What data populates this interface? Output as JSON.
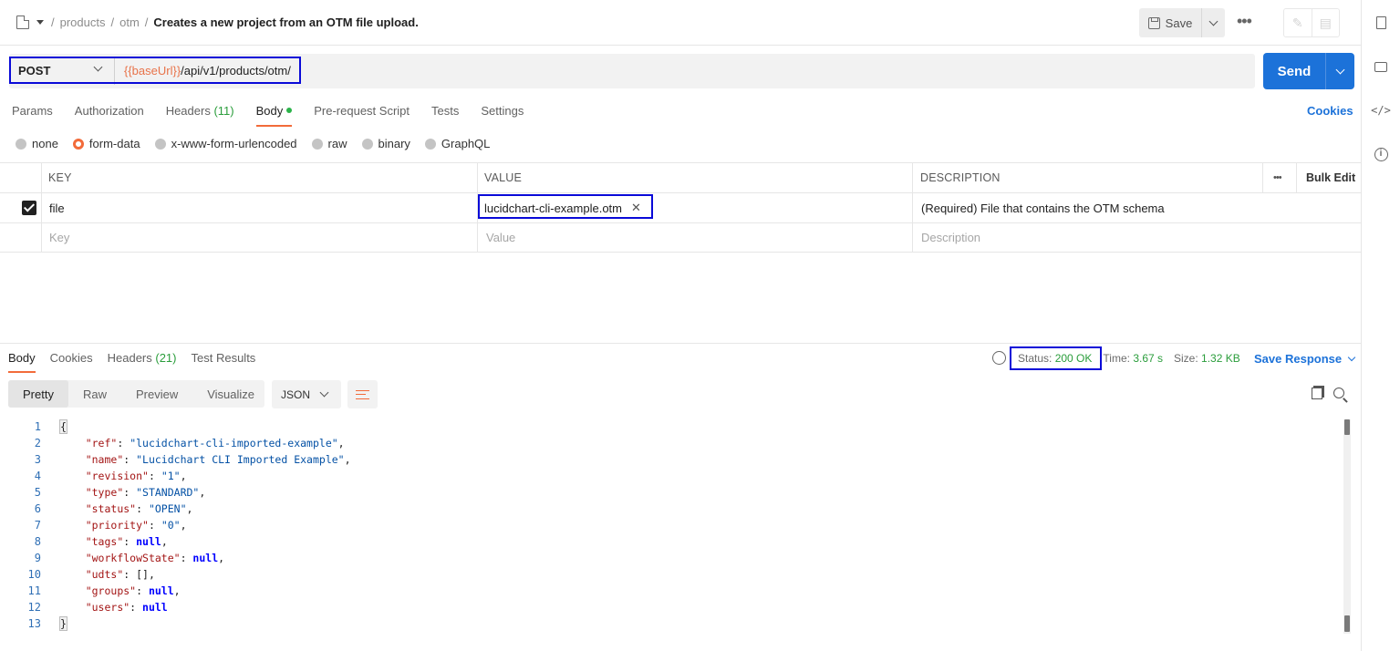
{
  "breadcrumb": {
    "segments": [
      "products",
      "otm"
    ],
    "separator": "/",
    "current": "Creates a new project from an OTM file upload."
  },
  "toolbar": {
    "save_label": "Save",
    "more_label": "•••"
  },
  "request": {
    "method": "POST",
    "url_variable": "{{baseUrl}}",
    "url_path": "/api/v1/products/otm/",
    "send_label": "Send"
  },
  "request_tabs": [
    {
      "label": "Params"
    },
    {
      "label": "Authorization"
    },
    {
      "label": "Headers",
      "count": "(11)"
    },
    {
      "label": "Body",
      "active": true
    },
    {
      "label": "Pre-request Script"
    },
    {
      "label": "Tests"
    },
    {
      "label": "Settings"
    }
  ],
  "cookies_label": "Cookies",
  "body_types": [
    "none",
    "form-data",
    "x-www-form-urlencoded",
    "raw",
    "binary",
    "GraphQL"
  ],
  "body_type_selected": "form-data",
  "params_table": {
    "headers": {
      "key": "KEY",
      "value": "VALUE",
      "description": "DESCRIPTION",
      "more": "•••",
      "bulk_edit": "Bulk Edit"
    },
    "rows": [
      {
        "key": "file",
        "value": "lucidchart-cli-example.otm",
        "description": "(Required) File that contains the OTM schema",
        "checked": true
      }
    ],
    "placeholders": {
      "key": "Key",
      "value": "Value",
      "description": "Description"
    }
  },
  "response": {
    "tabs": [
      {
        "label": "Body",
        "active": true
      },
      {
        "label": "Cookies"
      },
      {
        "label": "Headers",
        "count": "(21)"
      },
      {
        "label": "Test Results"
      }
    ],
    "status_label": "Status:",
    "status_value": "200 OK",
    "time_label": "Time:",
    "time_value": "3.67 s",
    "size_label": "Size:",
    "size_value": "1.32 KB",
    "save_response_label": "Save Response",
    "view_modes": [
      "Pretty",
      "Raw",
      "Preview",
      "Visualize"
    ],
    "format": "JSON"
  },
  "code_lines": [
    {
      "n": "1",
      "t": "{"
    },
    {
      "n": "2",
      "k": "\"ref\"",
      "v": "\"lucidchart-cli-imported-example\"",
      "vt": "str",
      "c": ","
    },
    {
      "n": "3",
      "k": "\"name\"",
      "v": "\"Lucidchart CLI Imported Example\"",
      "vt": "str",
      "c": ","
    },
    {
      "n": "4",
      "k": "\"revision\"",
      "v": "\"1\"",
      "vt": "str",
      "c": ","
    },
    {
      "n": "5",
      "k": "\"type\"",
      "v": "\"STANDARD\"",
      "vt": "str",
      "c": ","
    },
    {
      "n": "6",
      "k": "\"status\"",
      "v": "\"OPEN\"",
      "vt": "str",
      "c": ","
    },
    {
      "n": "7",
      "k": "\"priority\"",
      "v": "\"0\"",
      "vt": "str",
      "c": ","
    },
    {
      "n": "8",
      "k": "\"tags\"",
      "v": "null",
      "vt": "lit",
      "c": ","
    },
    {
      "n": "9",
      "k": "\"workflowState\"",
      "v": "null",
      "vt": "lit",
      "c": ","
    },
    {
      "n": "10",
      "k": "\"udts\"",
      "v": "[]",
      "vt": "plain",
      "c": ","
    },
    {
      "n": "11",
      "k": "\"groups\"",
      "v": "null",
      "vt": "lit",
      "c": ","
    },
    {
      "n": "12",
      "k": "\"users\"",
      "v": "null",
      "vt": "lit",
      "c": ""
    },
    {
      "n": "13",
      "t": "}"
    }
  ],
  "colors": {
    "accent": "#f26b3a",
    "send": "#1c72d9",
    "highlight": "#0a0ad8",
    "status_ok": "#2a9d3b"
  }
}
